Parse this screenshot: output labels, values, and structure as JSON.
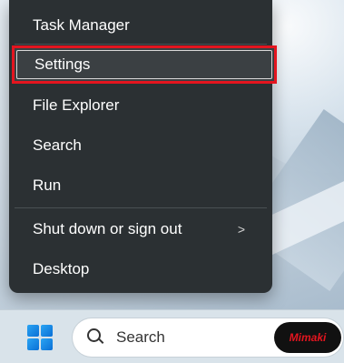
{
  "context_menu": {
    "items": [
      {
        "label": "Task Manager"
      },
      {
        "label": "Settings",
        "selected": true
      },
      {
        "label": "File Explorer"
      },
      {
        "label": "Search"
      },
      {
        "label": "Run"
      },
      {
        "label": "Shut down or sign out",
        "submenu_indicator": ">"
      },
      {
        "label": "Desktop"
      }
    ],
    "highlight_color": "#e4151f"
  },
  "taskbar": {
    "start_icon": "windows-logo-icon",
    "search": {
      "icon": "search-icon",
      "text": "Search"
    },
    "brand_badge": {
      "text": "Mimaki",
      "color": "#e4151f"
    }
  }
}
